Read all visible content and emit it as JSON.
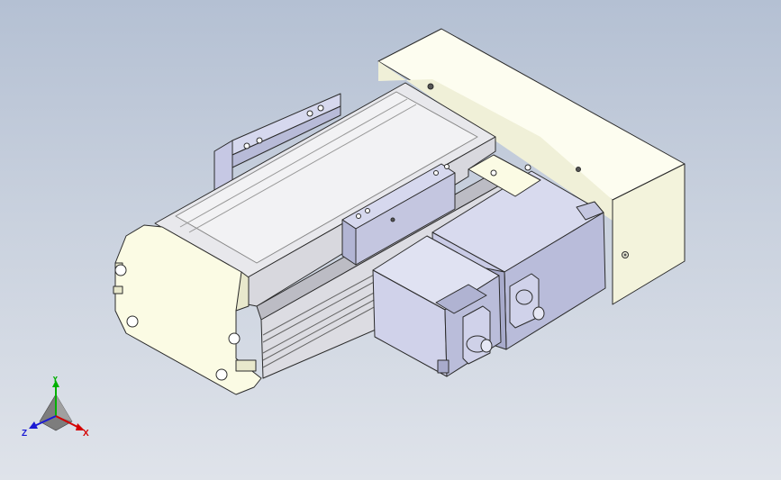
{
  "viewport": {
    "background_top": "#b4c0d3",
    "background_bottom": "#dfe3ea"
  },
  "model": {
    "body_color": "#fbfbe4",
    "edge_color": "#2b2b2b",
    "motor_color": "#c8cbe6",
    "rail_color": "#e6e6ea"
  },
  "triad": {
    "x_label": "X",
    "y_label": "Y",
    "z_label": "Z",
    "x_color": "#d40000",
    "y_color": "#00b000",
    "z_color": "#1a1ad4"
  }
}
